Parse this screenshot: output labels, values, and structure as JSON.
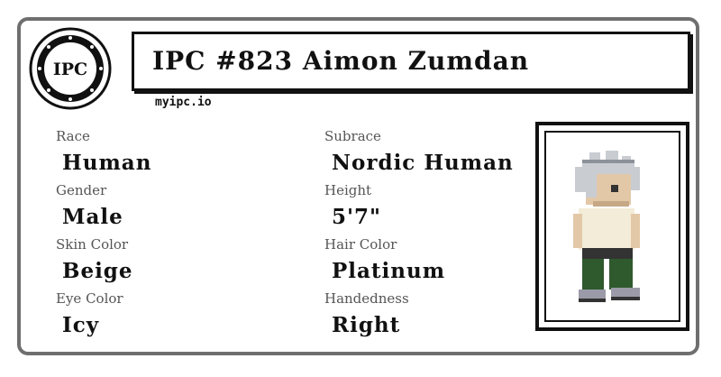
{
  "seal": {
    "text": "IPC"
  },
  "header": {
    "title": "IPC #823 Aimon Zumdan",
    "site": "myipc.io"
  },
  "fields": [
    {
      "label": "Race",
      "value": "Human"
    },
    {
      "label": "Subrace",
      "value": "Nordic Human"
    },
    {
      "label": "Gender",
      "value": "Male"
    },
    {
      "label": "Height",
      "value": "5'7\""
    },
    {
      "label": "Skin Color",
      "value": "Beige"
    },
    {
      "label": "Hair Color",
      "value": "Platinum"
    },
    {
      "label": "Eye Color",
      "value": "Icy"
    },
    {
      "label": "Handedness",
      "value": "Right"
    }
  ],
  "colors": {
    "border": "#6f6f6f",
    "ink": "#111111",
    "label": "#555555",
    "skin": "#e3c8a8",
    "hair": "#c9cdd2",
    "shirt": "#f2ecd8",
    "pants": "#2f5a2e"
  }
}
